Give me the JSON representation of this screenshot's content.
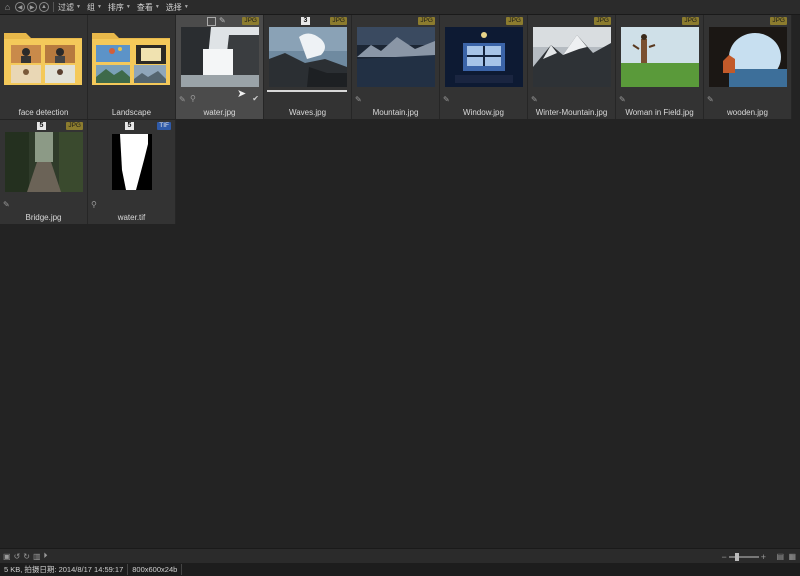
{
  "toolbar": {
    "menus": [
      "过滤",
      "组",
      "排序",
      "查看",
      "选择"
    ]
  },
  "tiles": [
    {
      "label": "face detection",
      "type": "folder"
    },
    {
      "label": "Landscape",
      "type": "folder"
    },
    {
      "label": "water.jpg",
      "badge": "JPG",
      "selected": true
    },
    {
      "label": "Waves.jpg",
      "badge": "JPG",
      "count": "3"
    },
    {
      "label": "Mountain.jpg",
      "badge": "JPG"
    },
    {
      "label": "Window.jpg",
      "badge": "JPG"
    },
    {
      "label": "Winter-Mountain.jpg",
      "badge": "JPG"
    },
    {
      "label": "Woman in Field.jpg",
      "badge": "JPG"
    },
    {
      "label": "wooden.jpg",
      "badge": "JPG"
    },
    {
      "label": "Bridge.jpg",
      "badge": "JPG",
      "count": "5"
    },
    {
      "label": "water.tif",
      "badge": "TIF",
      "count": "5"
    }
  ],
  "status": {
    "info": "5 KB, 拍摄日期: 2014/8/17 14:59:17",
    "dimensions": "800x600x24b"
  },
  "colors": {
    "jpg_badge": "#8c7c2e",
    "tif_badge": "#2f5aa8",
    "background": "#232323"
  }
}
